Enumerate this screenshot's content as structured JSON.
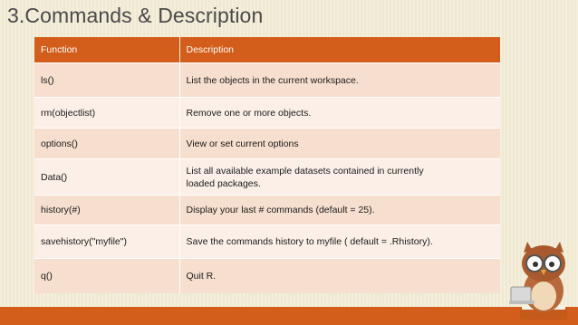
{
  "title": "3.Commands & Description",
  "table": {
    "headers": [
      "Function",
      "Description"
    ],
    "rows": [
      [
        "ls()",
        "List the objects in the current workspace."
      ],
      [
        "rm(objectlist)",
        "Remove one or more objects."
      ],
      [
        "options()",
        "View or set current options"
      ],
      [
        "Data()",
        "List all available example datasets contained in currently loaded packages."
      ],
      [
        "history(#)",
        "Display your last # commands (default = 25)."
      ],
      [
        "savehistory(\"myfile\")",
        "Save the commands history to myfile ( default = .Rhistory)."
      ],
      [
        "q()",
        "Quit R."
      ]
    ]
  },
  "colors": {
    "accent": "#d35d1a",
    "background": "#f3ecd6",
    "row_odd": "#f7dfcf",
    "row_even": "#fbefe7"
  },
  "icons": {
    "mascot": "owl-reading-icon"
  }
}
